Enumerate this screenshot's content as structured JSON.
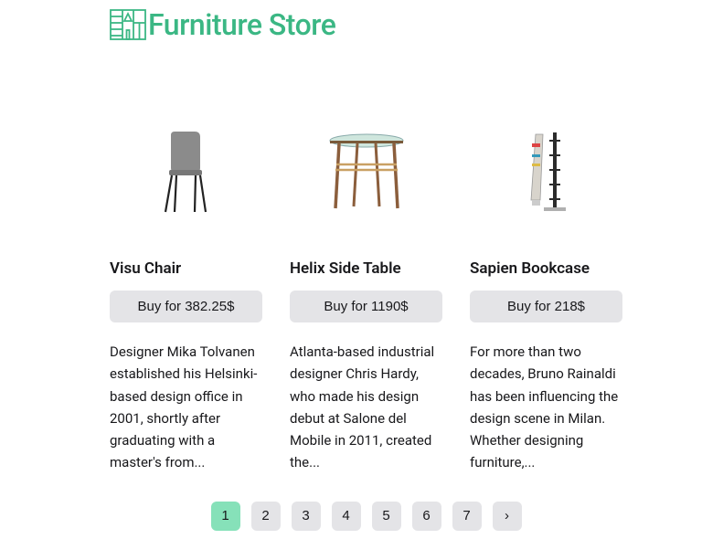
{
  "brand": {
    "name": "Furniture Store"
  },
  "products": [
    {
      "title": "Visu Chair",
      "buy_label": "Buy for 382.25$",
      "description": "Designer Mika Tolvanen established his Helsinki-based design office in 2001, shortly after graduating with a master's from..."
    },
    {
      "title": "Helix Side Table",
      "buy_label": "Buy for 1190$",
      "description": "Atlanta-based industrial designer Chris Hardy, who made his design debut at Salone del Mobile in 2011, created the..."
    },
    {
      "title": "Sapien Bookcase",
      "buy_label": "Buy for 218$",
      "description": "For more than two decades, Bruno Rainaldi has been influencing the design scene in Milan. Whether designing furniture,..."
    }
  ],
  "pagination": {
    "pages": [
      "1",
      "2",
      "3",
      "4",
      "5",
      "6",
      "7",
      "›"
    ],
    "active_index": 0
  }
}
